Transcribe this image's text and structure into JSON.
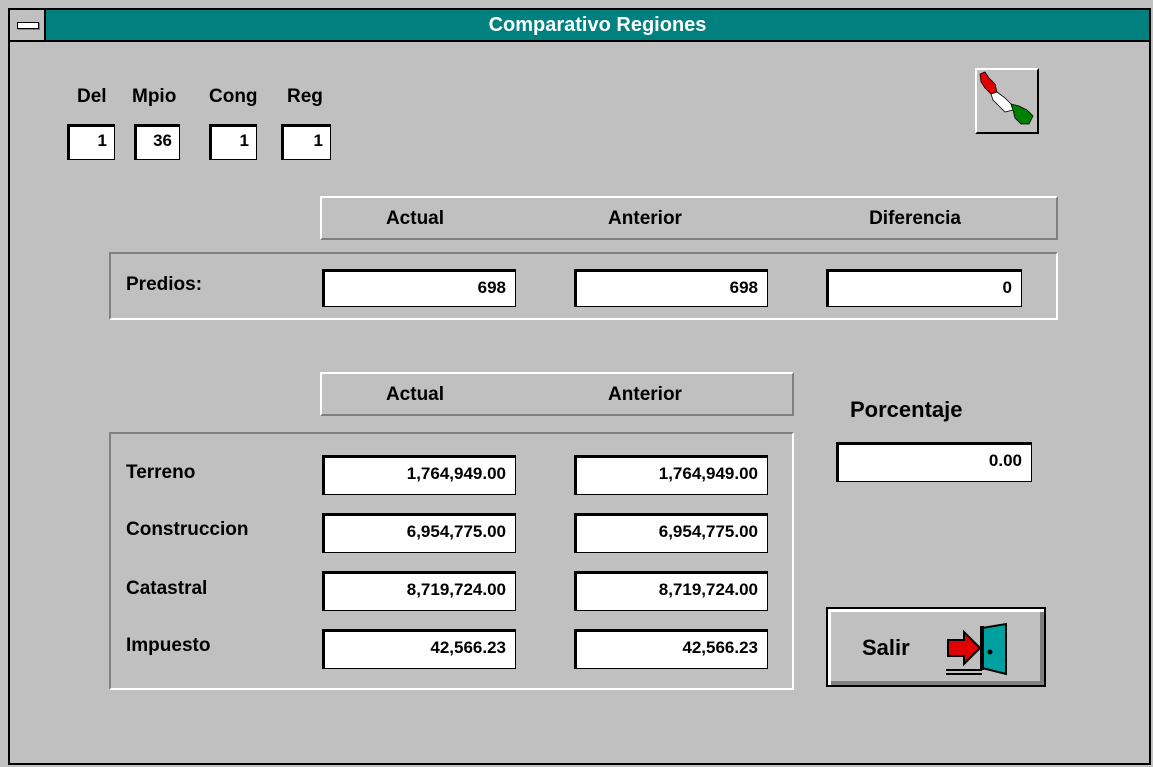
{
  "window": {
    "title": "Comparativo Regiones"
  },
  "header_fields": [
    {
      "label": "Del",
      "value": "1"
    },
    {
      "label": "Mpio",
      "value": "36"
    },
    {
      "label": "Cong",
      "value": "1"
    },
    {
      "label": "Reg",
      "value": "1"
    }
  ],
  "predios_section": {
    "columns": [
      "Actual",
      "Anterior",
      "Diferencia"
    ],
    "row_label": "Predios:",
    "actual": "698",
    "anterior": "698",
    "diferencia": "0"
  },
  "valores_section": {
    "columns": [
      "Actual",
      "Anterior"
    ],
    "rows": [
      {
        "label": "Terreno",
        "actual": "1,764,949.00",
        "anterior": "1,764,949.00"
      },
      {
        "label": "Construccion",
        "actual": "6,954,775.00",
        "anterior": "6,954,775.00"
      },
      {
        "label": "Catastral",
        "actual": "8,719,724.00",
        "anterior": "8,719,724.00"
      },
      {
        "label": "Impuesto",
        "actual": "42,566.23",
        "anterior": "42,566.23"
      }
    ]
  },
  "porcentaje": {
    "label": "Porcentaje",
    "value": "0.00"
  },
  "exit_button": {
    "label": "Salir",
    "icon": "exit-door-icon"
  },
  "logo": {
    "icon": "map-flag-logo"
  },
  "colors": {
    "titlebar": "#00807f",
    "face": "#c0c0c0",
    "field": "#ffffff"
  }
}
